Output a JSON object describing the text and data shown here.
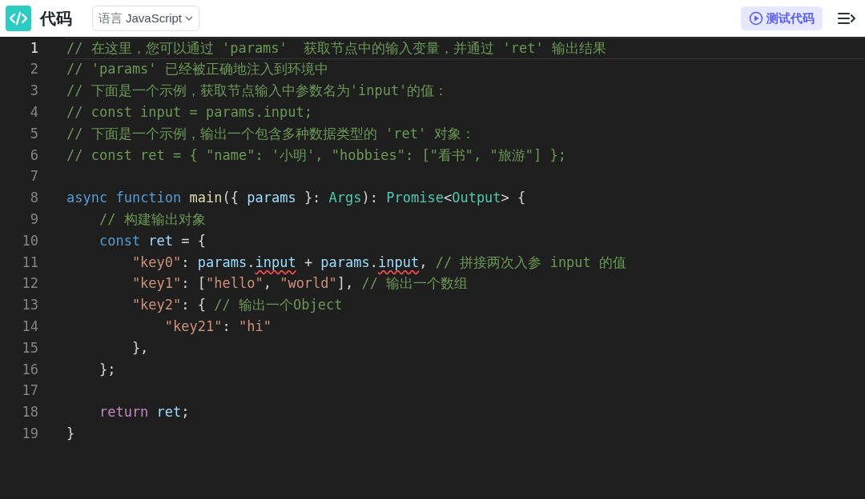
{
  "header": {
    "title": "代码",
    "language_select": {
      "label": "语言",
      "value": "JavaScript"
    },
    "test_button": "测试代码"
  },
  "editor": {
    "lines": [
      {
        "number": "1",
        "active": true,
        "tokens": [
          {
            "kind": "comment",
            "text": "// 在这里，您可以通过 'params'  获取节点中的输入变量，并通过 'ret' 输出结果"
          }
        ]
      },
      {
        "number": "2",
        "active": false,
        "tokens": [
          {
            "kind": "comment",
            "text": "// 'params' 已经被正确地注入到环境中"
          }
        ]
      },
      {
        "number": "3",
        "active": false,
        "tokens": [
          {
            "kind": "comment",
            "text": "// 下面是一个示例，获取节点输入中参数名为'input'的值："
          }
        ]
      },
      {
        "number": "4",
        "active": false,
        "tokens": [
          {
            "kind": "comment",
            "text": "// const input = params.input;"
          }
        ]
      },
      {
        "number": "5",
        "active": false,
        "tokens": [
          {
            "kind": "comment",
            "text": "// 下面是一个示例，输出一个包含多种数据类型的 'ret' 对象："
          }
        ]
      },
      {
        "number": "6",
        "active": false,
        "tokens": [
          {
            "kind": "comment",
            "text": "// const ret = { \"name\": '小明', \"hobbies\": [\"看书\", \"旅游\"] };"
          }
        ]
      },
      {
        "number": "7",
        "active": false
      },
      {
        "number": "8",
        "active": false,
        "tokens": [
          {
            "kind": "keyword",
            "text": "async "
          },
          {
            "kind": "keyword",
            "text": "function "
          },
          {
            "kind": "function",
            "text": "main"
          },
          {
            "kind": "plain",
            "text": "({ "
          },
          {
            "kind": "variable",
            "text": "params",
            "error": false
          },
          {
            "kind": "plain",
            "text": " }: "
          },
          {
            "kind": "type",
            "text": "Args"
          },
          {
            "kind": "plain",
            "text": "): "
          },
          {
            "kind": "type",
            "text": "Promise"
          },
          {
            "kind": "plain",
            "text": "<"
          },
          {
            "kind": "type",
            "text": "Output"
          },
          {
            "kind": "plain",
            "text": "> {"
          }
        ]
      },
      {
        "number": "9",
        "active": false,
        "tokens": [
          {
            "kind": "comment",
            "text": "    // 构建输出对象"
          }
        ]
      },
      {
        "number": "10",
        "active": false,
        "tokens": [
          {
            "kind": "keyword",
            "text": "    const "
          },
          {
            "kind": "variable",
            "text": "ret",
            "error": false
          },
          {
            "kind": "plain",
            "text": " = {"
          }
        ]
      },
      {
        "number": "11",
        "active": false,
        "tokens": [
          {
            "kind": "string",
            "text": "        \"key0\""
          },
          {
            "kind": "plain",
            "text": ": "
          },
          {
            "kind": "variable",
            "text": "params",
            "error": false
          },
          {
            "kind": "plain",
            "text": "."
          },
          {
            "kind": "variable",
            "text": "input",
            "error": true
          },
          {
            "kind": "plain",
            "text": " + "
          },
          {
            "kind": "variable",
            "text": "params",
            "error": false
          },
          {
            "kind": "plain",
            "text": "."
          },
          {
            "kind": "variable",
            "text": "input",
            "error": true
          },
          {
            "kind": "plain",
            "text": ", "
          },
          {
            "kind": "comment",
            "text": "// 拼接两次入参 input 的值"
          }
        ]
      },
      {
        "number": "12",
        "active": false,
        "tokens": [
          {
            "kind": "string",
            "text": "        \"key1\""
          },
          {
            "kind": "plain",
            "text": ": ["
          },
          {
            "kind": "string",
            "text": "\"hello\""
          },
          {
            "kind": "plain",
            "text": ", "
          },
          {
            "kind": "string",
            "text": "\"world\""
          },
          {
            "kind": "plain",
            "text": "], "
          },
          {
            "kind": "comment",
            "text": "// 输出一个数组"
          }
        ]
      },
      {
        "number": "13",
        "active": false,
        "tokens": [
          {
            "kind": "string",
            "text": "        \"key2\""
          },
          {
            "kind": "plain",
            "text": ": { "
          },
          {
            "kind": "comment",
            "text": "// 输出一个Object"
          }
        ]
      },
      {
        "number": "14",
        "active": false,
        "tokens": [
          {
            "kind": "string",
            "text": "            \"key21\""
          },
          {
            "kind": "plain",
            "text": ": "
          },
          {
            "kind": "string",
            "text": "\"hi\""
          }
        ]
      },
      {
        "number": "15",
        "active": false,
        "tokens": [
          {
            "kind": "plain",
            "text": "        },"
          }
        ]
      },
      {
        "number": "16",
        "active": false,
        "tokens": [
          {
            "kind": "plain",
            "text": "    };"
          }
        ]
      },
      {
        "number": "17",
        "active": false
      },
      {
        "number": "18",
        "active": false,
        "tokens": [
          {
            "kind": "control",
            "text": "    return "
          },
          {
            "kind": "variable",
            "text": "ret",
            "error": false
          },
          {
            "kind": "plain",
            "text": ";"
          }
        ]
      },
      {
        "number": "19",
        "active": false,
        "tokens": [
          {
            "kind": "plain",
            "text": "}"
          }
        ]
      }
    ]
  }
}
